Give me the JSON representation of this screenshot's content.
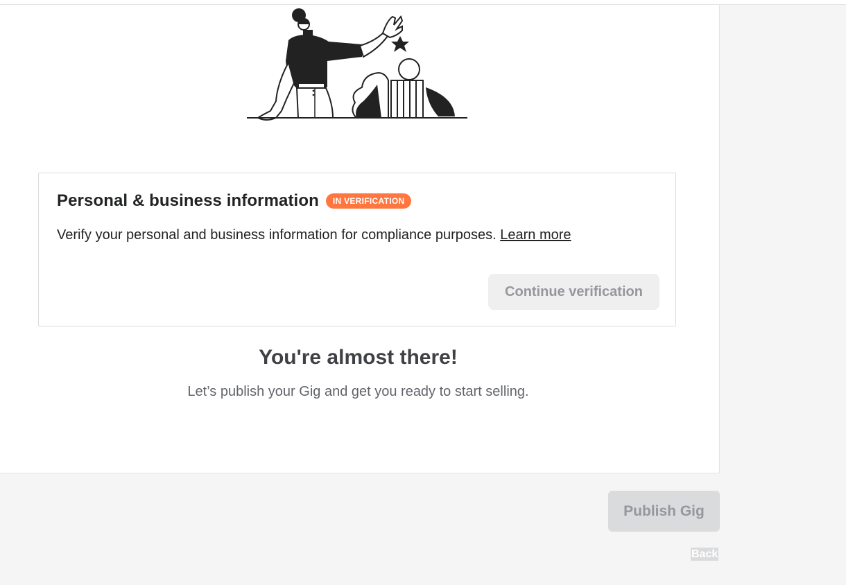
{
  "card": {
    "title": "Personal & business information",
    "badge": "IN VERIFICATION",
    "description": "Verify your personal and business information for compliance purposes.",
    "learn_more": "Learn more",
    "button": "Continue verification"
  },
  "headline": "You're almost there!",
  "subtext": "Let’s publish your Gig and get you ready to start selling.",
  "footer": {
    "publish_label": "Publish Gig",
    "back_label": "Back"
  },
  "colors": {
    "badge": "#ff7640",
    "disabled_button": "#dadbdd",
    "page_background": "#f5f5f5"
  }
}
